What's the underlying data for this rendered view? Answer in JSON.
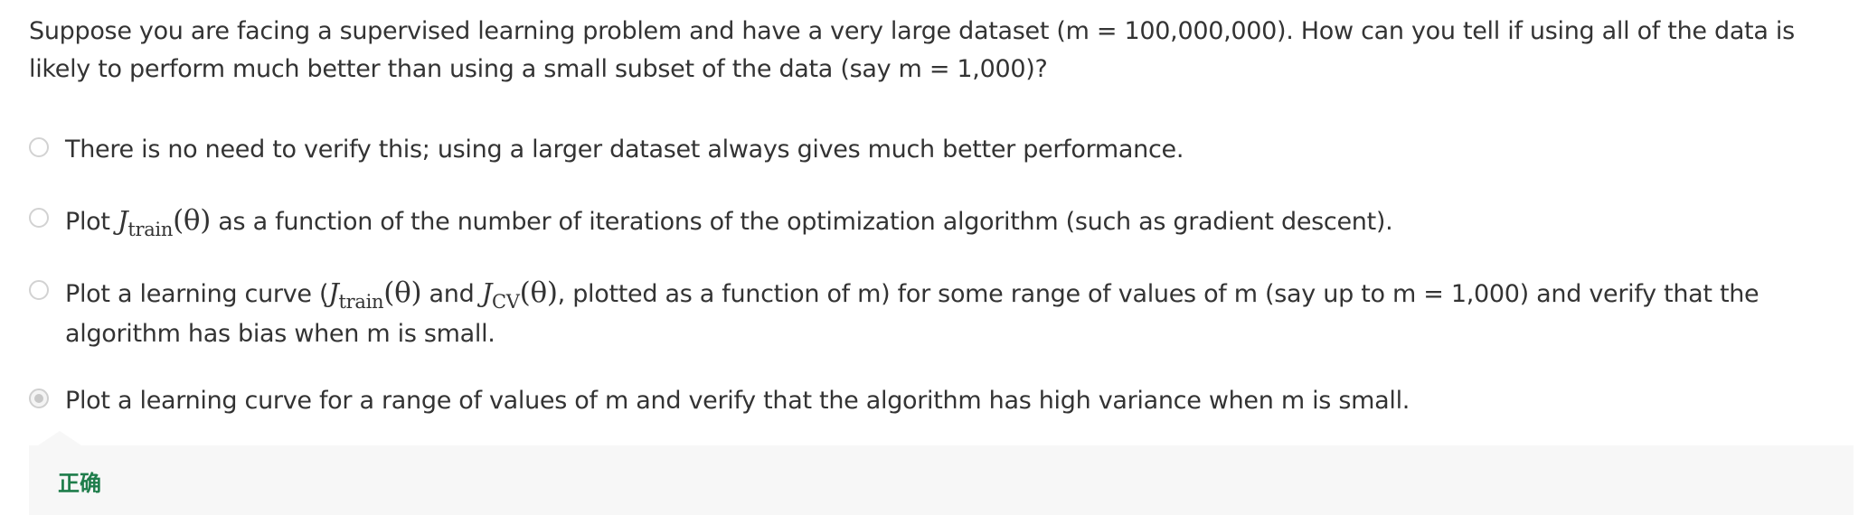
{
  "question": {
    "text": "Suppose you are facing a supervised learning problem and have a very large dataset (m = 100,000,000). How can you tell if using all of the data is likely to perform much better than using a small subset of the data (say m = 1,000)?"
  },
  "options": [
    {
      "text": "There is no need to verify this; using a larger dataset always gives much better performance.",
      "selected": false
    },
    {
      "prefix": "Plot ",
      "math_symbol": "J",
      "math_sub": "train",
      "math_arg": "(θ)",
      "suffix": " as a function of the number of iterations of the optimization algorithm (such as gradient descent).",
      "selected": false
    },
    {
      "prefix": "Plot a learning curve (",
      "math1_symbol": "J",
      "math1_sub": "train",
      "math1_arg": "(θ)",
      "middle": " and ",
      "math2_symbol": "J",
      "math2_sub": "CV",
      "math2_arg": "(θ)",
      "suffix": ", plotted as a function of m) for some range of values of m (say up to m = 1,000) and verify that the algorithm has bias when m is small.",
      "selected": false
    },
    {
      "text": "Plot a learning curve for a range of values of m and verify that the algorithm has high variance when m is small.",
      "selected": true
    }
  ],
  "feedback": {
    "label": "正确",
    "color": "#1f7d4b"
  }
}
